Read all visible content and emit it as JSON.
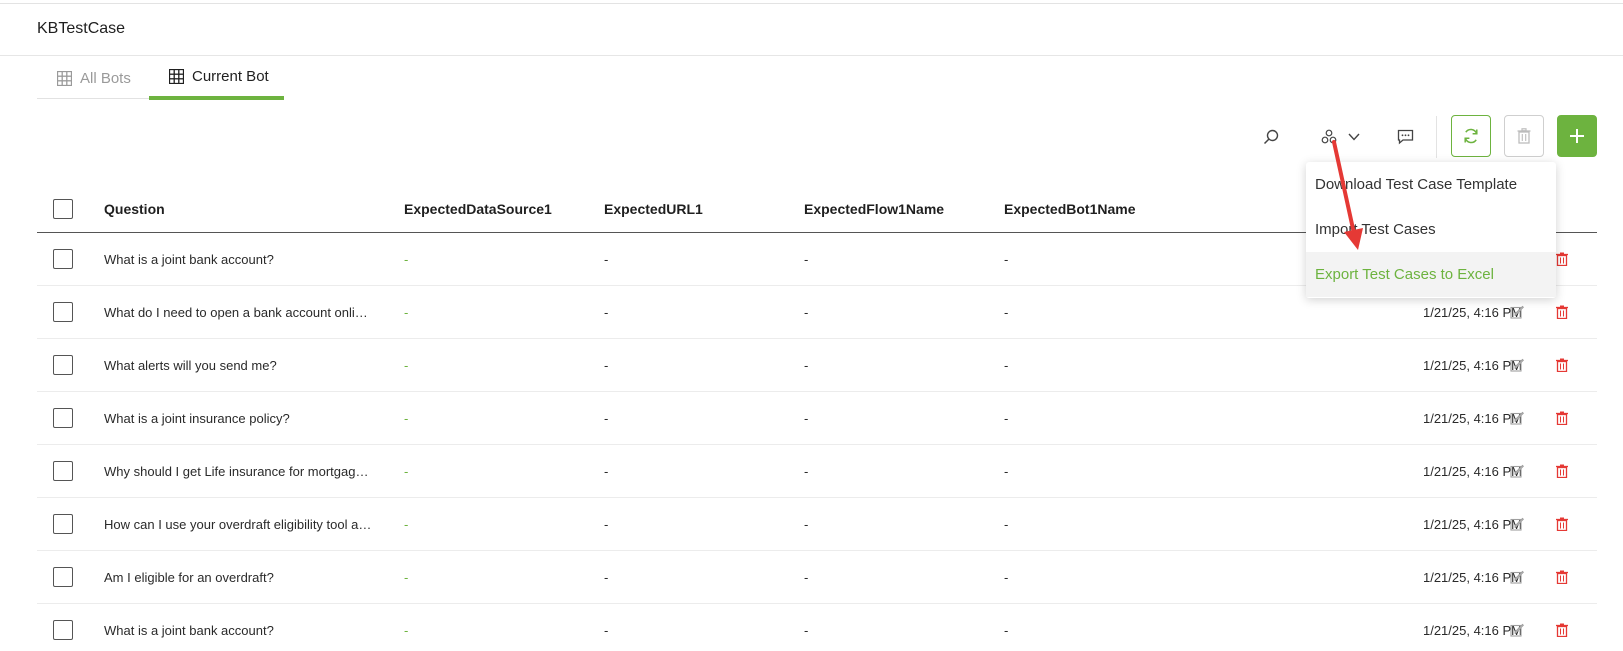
{
  "page": {
    "title": "KBTestCase"
  },
  "tabs": [
    {
      "label": "All Bots",
      "icon": "grid-icon",
      "active": false
    },
    {
      "label": "Current Bot",
      "icon": "grid-icon",
      "active": true
    }
  ],
  "toolbar": {
    "search_icon": "search-icon",
    "group_icon": "group-icon",
    "comment_icon": "comment-icon",
    "refresh_icon": "refresh-icon",
    "delete_icon": "trash-icon",
    "add_label": "+"
  },
  "colors": {
    "accent": "#6db33f",
    "danger": "#e53935"
  },
  "table": {
    "columns": [
      "Question",
      "ExpectedDataSource1",
      "ExpectedURL1",
      "ExpectedFlow1Name",
      "ExpectedBot1Name"
    ],
    "rows": [
      {
        "question": "What is a joint bank account?",
        "ds": "-",
        "url": "-",
        "flow": "-",
        "bot": "-",
        "date": ""
      },
      {
        "question": "What do I need to open a bank account online?",
        "ds": "-",
        "url": "-",
        "flow": "-",
        "bot": "-",
        "date": "1/21/25, 4:16 PM"
      },
      {
        "question": "What alerts will you send me?",
        "ds": "-",
        "url": "-",
        "flow": "-",
        "bot": "-",
        "date": "1/21/25, 4:16 PM"
      },
      {
        "question": "What is a joint insurance policy?",
        "ds": "-",
        "url": "-",
        "flow": "-",
        "bot": "-",
        "date": "1/21/25, 4:16 PM"
      },
      {
        "question": "Why should I get Life insurance for mortgage protection?",
        "ds": "-",
        "url": "-",
        "flow": "-",
        "bot": "-",
        "date": "1/21/25, 4:16 PM"
      },
      {
        "question": "How can I use your overdraft eligibility tool and what do I need?",
        "ds": "-",
        "url": "-",
        "flow": "-",
        "bot": "-",
        "date": "1/21/25, 4:16 PM"
      },
      {
        "question": "Am I eligible for an overdraft?",
        "ds": "-",
        "url": "-",
        "flow": "-",
        "bot": "-",
        "date": "1/21/25, 4:16 PM"
      },
      {
        "question": "What is a joint bank account?",
        "ds": "-",
        "url": "-",
        "flow": "-",
        "bot": "-",
        "date": "1/21/25, 4:16 PM"
      }
    ]
  },
  "dropdown": {
    "items": [
      {
        "label": "Download Test Case Template",
        "active": false
      },
      {
        "label": "Import Test Cases",
        "active": false
      },
      {
        "label": "Export Test Cases to Excel",
        "active": true
      }
    ]
  }
}
